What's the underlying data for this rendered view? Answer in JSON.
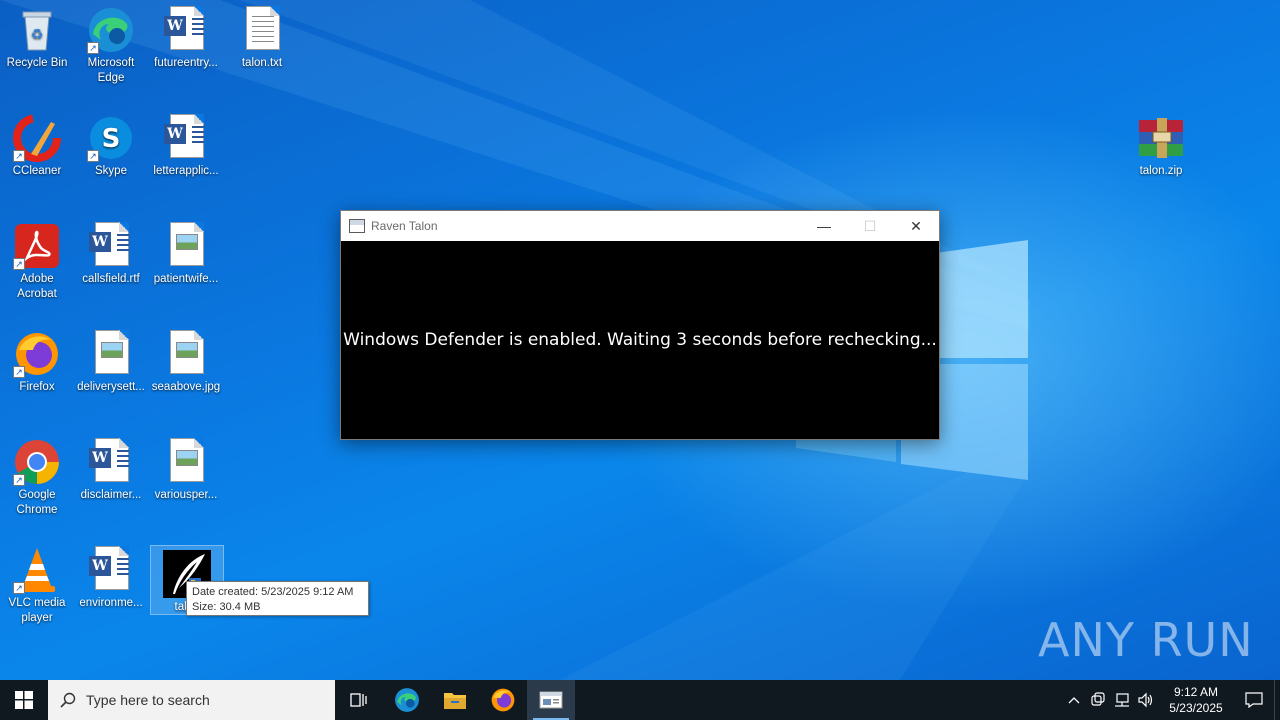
{
  "desktop": {
    "icons": [
      {
        "label": "Recycle Bin"
      },
      {
        "label": "Microsoft Edge"
      },
      {
        "label": "futureentry..."
      },
      {
        "label": "talon.txt"
      },
      {
        "label": "CCleaner"
      },
      {
        "label": "Skype"
      },
      {
        "label": "letterapplic..."
      },
      {
        "label": "Adobe Acrobat"
      },
      {
        "label": "callsfield.rtf"
      },
      {
        "label": "patientwife..."
      },
      {
        "label": "Firefox"
      },
      {
        "label": "deliverysett..."
      },
      {
        "label": "seaabove.jpg"
      },
      {
        "label": "Google Chrome"
      },
      {
        "label": "disclaimer..."
      },
      {
        "label": "variousper..."
      },
      {
        "label": "VLC media player"
      },
      {
        "label": "environme..."
      },
      {
        "label": "talon"
      },
      {
        "label": "talon.zip"
      }
    ]
  },
  "window": {
    "title": "Raven Talon",
    "message": "Windows Defender is enabled. Waiting 3 seconds before rechecking...",
    "minimize_glyph": "—",
    "maximize_glyph": "☐",
    "close_glyph": "✕"
  },
  "tooltip": {
    "line1": "Date created: 5/23/2025 9:12 AM",
    "line2": "Size: 30.4 MB"
  },
  "watermark": {
    "text": "ANY RUN"
  },
  "taskbar": {
    "search_placeholder": "Type here to search",
    "time": "9:12 AM",
    "date": "5/23/2025"
  },
  "colors": {
    "desktop_blue": "#0a6fd6",
    "taskbar": "#101820",
    "console_bg": "#000000",
    "console_text": "#ffffff"
  }
}
